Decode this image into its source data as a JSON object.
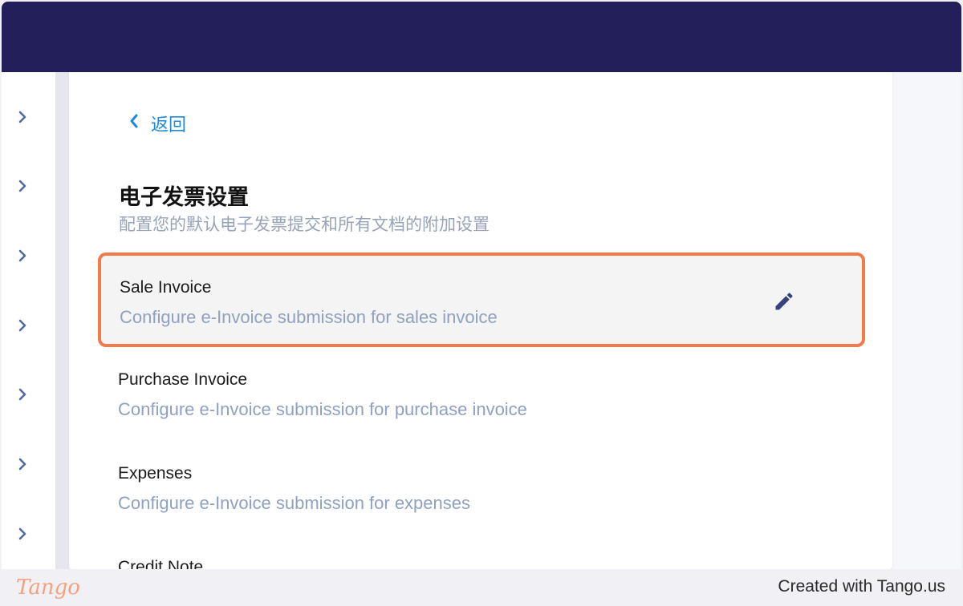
{
  "nav": {
    "back_label": "返回"
  },
  "section": {
    "title": "电子发票设置",
    "subtitle": "配置您的默认电子发票提交和所有文档的附加设置"
  },
  "settings": [
    {
      "title": "Sale Invoice",
      "description": "Configure e-Invoice submission for sales invoice",
      "highlighted": true,
      "action_icon": "pencil-icon"
    },
    {
      "title": "Purchase Invoice",
      "description": "Configure e-Invoice submission for purchase invoice"
    },
    {
      "title": "Expenses",
      "description": "Configure e-Invoice submission for expenses"
    },
    {
      "title": "Credit Note"
    }
  ],
  "sidebar": {
    "icon": "chevron-right-icon",
    "count": 7
  },
  "footer": {
    "logo_text": "Tango",
    "credit": "Created with Tango.us"
  },
  "colors": {
    "topbar": "#221f5b",
    "accent_link": "#1c8ad6",
    "highlight_border": "#f07a4a",
    "edit_icon": "#34447a",
    "subtitle_text": "#96a3b8"
  }
}
